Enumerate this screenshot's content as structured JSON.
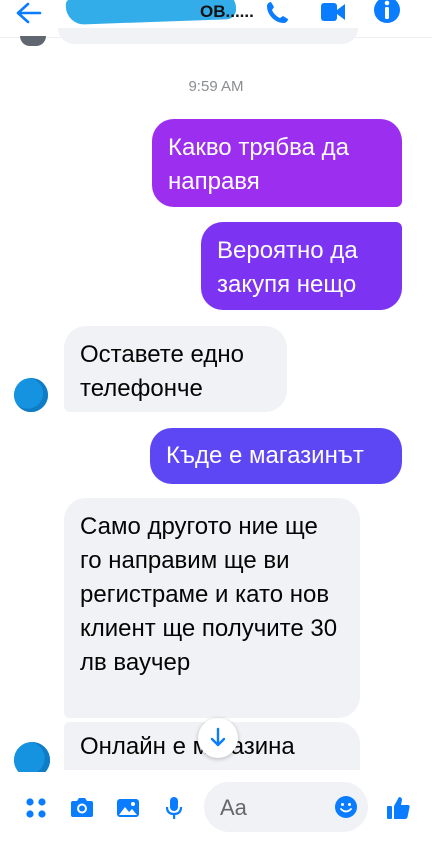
{
  "header": {
    "contact_name_visible": "ОВ......",
    "icons": [
      "back-arrow-icon",
      "phone-icon",
      "video-icon",
      "info-icon"
    ]
  },
  "thread": {
    "timestamp": "9:59 AM",
    "messages": [
      {
        "from": "me",
        "text": "Какво трябва да направя"
      },
      {
        "from": "me",
        "text": "Вероятно да закупя нещо"
      },
      {
        "from": "them",
        "text": "Оставете едно телефонче"
      },
      {
        "from": "me",
        "text": "Къде е магазинът"
      },
      {
        "from": "them",
        "text": "Само другото ние ще го направим ще ви регистраме и като нов клиент ще получите 30 лв ваучер"
      },
      {
        "from": "them",
        "text": "Онлайн е магазина"
      }
    ]
  },
  "composer": {
    "placeholder": "Aa",
    "icons": [
      "apps-icon",
      "camera-icon",
      "gallery-icon",
      "microphone-icon",
      "emoji-icon",
      "like-icon"
    ]
  },
  "colors": {
    "accent": "#7b2ff7",
    "incoming_bubble": "#f0f2f5",
    "icon_blue": "#0a7cff"
  }
}
